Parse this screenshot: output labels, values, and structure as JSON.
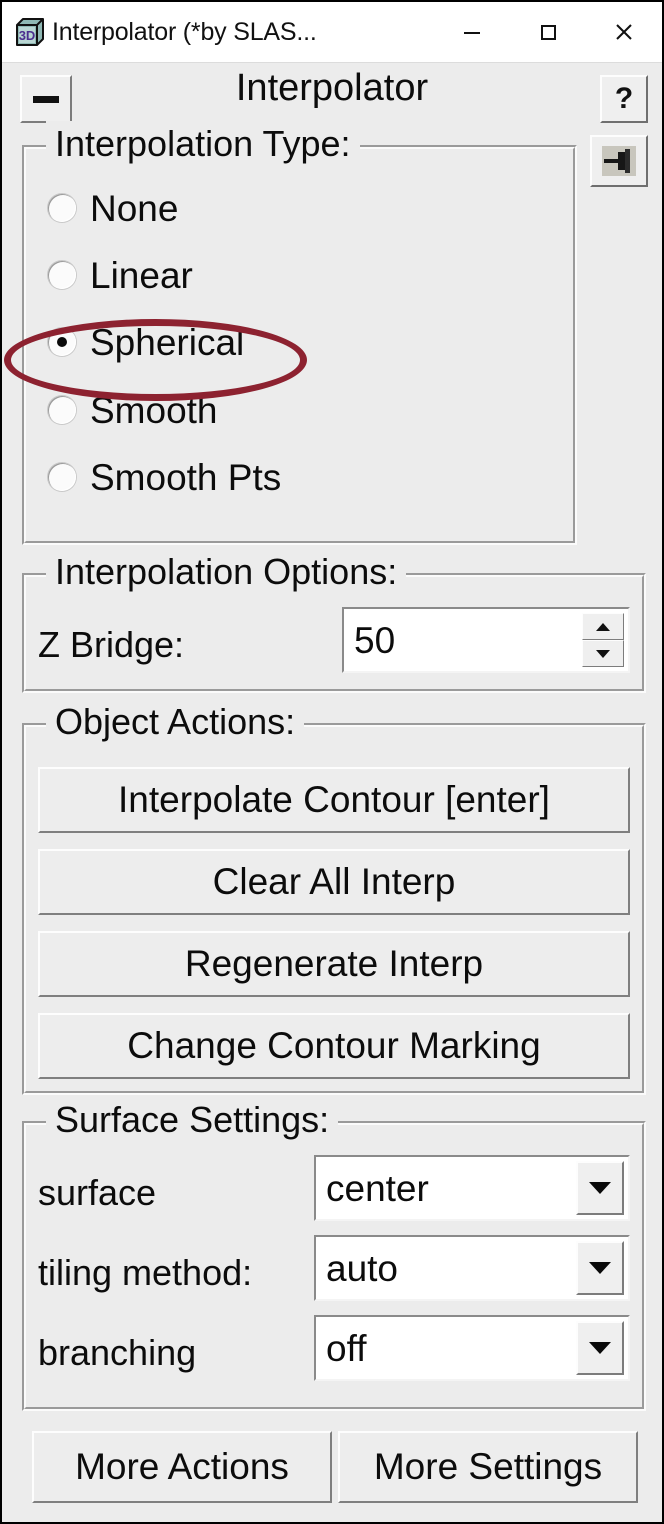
{
  "window": {
    "title": "Interpolator (*by SLAS...",
    "app_icon": "cube-3d-icon",
    "controls": {
      "minimize": "minimize-icon",
      "maximize": "maximize-icon",
      "close": "close-icon"
    }
  },
  "header": {
    "collapse_label": "collapse",
    "title": "Interpolator",
    "help_label": "?",
    "pin_label": "pin"
  },
  "interpolation_type": {
    "title": "Interpolation Type:",
    "options": [
      {
        "label": "None",
        "selected": false
      },
      {
        "label": "Linear",
        "selected": false
      },
      {
        "label": "Spherical",
        "selected": true
      },
      {
        "label": "Smooth",
        "selected": false
      },
      {
        "label": "Smooth Pts",
        "selected": false
      }
    ],
    "annotation": {
      "shape": "ellipse",
      "color": "#8d2230",
      "target": "Spherical"
    }
  },
  "interpolation_options": {
    "title": "Interpolation Options:",
    "z_bridge": {
      "label": "Z Bridge:",
      "value": "50"
    }
  },
  "object_actions": {
    "title": "Object Actions:",
    "buttons": [
      "Interpolate Contour [enter]",
      "Clear All Interp",
      "Regenerate Interp",
      "Change Contour Marking"
    ]
  },
  "surface_settings": {
    "title": "Surface Settings:",
    "rows": [
      {
        "label": "surface",
        "value": "center"
      },
      {
        "label": "tiling method:",
        "value": "auto"
      },
      {
        "label": "branching",
        "value": "off"
      }
    ]
  },
  "footer": {
    "more_actions": "More Actions",
    "more_settings": "More Settings"
  }
}
